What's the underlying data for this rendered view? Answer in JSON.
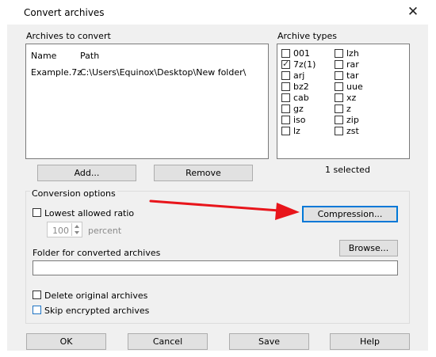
{
  "window": {
    "title": "Convert archives",
    "close_glyph": "✕"
  },
  "archives": {
    "section_label": "Archives to convert",
    "columns": [
      "Name",
      "Path"
    ],
    "rows": [
      {
        "name": "Example.7z",
        "path": "C:\\Users\\Equinox\\Desktop\\New folder\\"
      }
    ],
    "add_label": "Add...",
    "remove_label": "Remove"
  },
  "types": {
    "section_label": "Archive types",
    "items": [
      {
        "label": "001",
        "checked": false
      },
      {
        "label": "7z(1)",
        "checked": true
      },
      {
        "label": "arj",
        "checked": false
      },
      {
        "label": "bz2",
        "checked": false
      },
      {
        "label": "cab",
        "checked": false
      },
      {
        "label": "gz",
        "checked": false
      },
      {
        "label": "iso",
        "checked": false
      },
      {
        "label": "lz",
        "checked": false
      },
      {
        "label": "lzh",
        "checked": false
      },
      {
        "label": "rar",
        "checked": false
      },
      {
        "label": "tar",
        "checked": false
      },
      {
        "label": "uue",
        "checked": false
      },
      {
        "label": "xz",
        "checked": false
      },
      {
        "label": "z",
        "checked": false
      },
      {
        "label": "zip",
        "checked": false
      },
      {
        "label": "zst",
        "checked": false
      }
    ],
    "selected_text": "1 selected"
  },
  "options": {
    "section_label": "Conversion options",
    "lowest_ratio_label": "Lowest allowed ratio",
    "ratio_value": "100",
    "percent_label": "percent",
    "compression_label": "Compression...",
    "folder_label": "Folder for converted archives",
    "folder_value": "",
    "browse_label": "Browse...",
    "delete_original_label": "Delete original archives",
    "skip_encrypted_label": "Skip encrypted archives"
  },
  "footer": {
    "ok": "OK",
    "cancel": "Cancel",
    "save": "Save",
    "help": "Help"
  },
  "annotation": {
    "arrow_color": "#e8151b"
  }
}
